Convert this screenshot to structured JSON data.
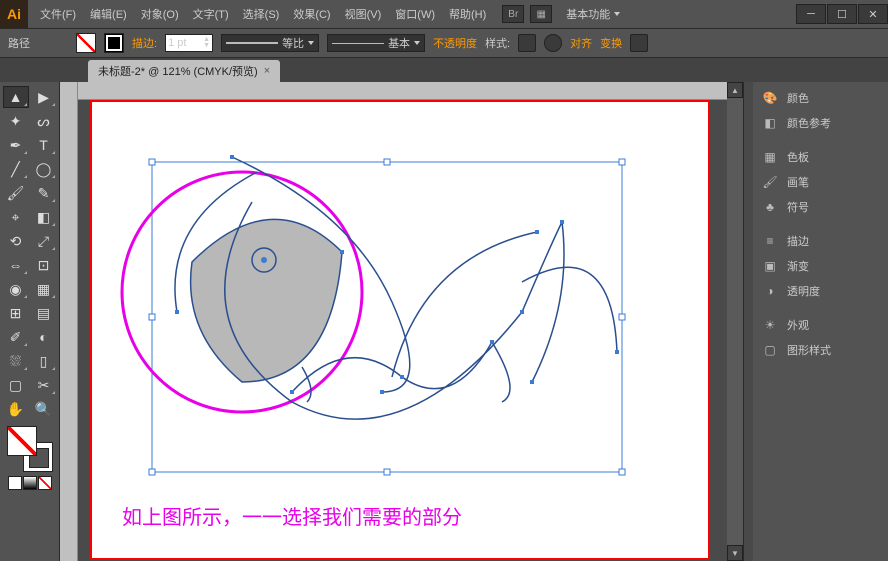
{
  "menus": [
    "文件(F)",
    "编辑(E)",
    "对象(O)",
    "文字(T)",
    "选择(S)",
    "效果(C)",
    "视图(V)",
    "窗口(W)",
    "帮助(H)"
  ],
  "workspace": "基本功能",
  "controlbar": {
    "path_label": "路径",
    "stroke_label": "描边:",
    "stroke_pt": "1 pt",
    "proportion": "等比",
    "style_basic": "基本",
    "opacity_label": "不透明度",
    "style_label": "样式:",
    "align_label": "对齐",
    "transform_label": "变换"
  },
  "tab": {
    "title": "未标题-2* @ 121% (CMYK/预览)",
    "close": "×"
  },
  "br_icon": "Br",
  "panels": {
    "g1": [
      {
        "icon": "palette",
        "label": "颜色"
      },
      {
        "icon": "guide",
        "label": "颜色参考"
      }
    ],
    "g2": [
      {
        "icon": "swatches",
        "label": "色板"
      },
      {
        "icon": "brushes",
        "label": "画笔"
      },
      {
        "icon": "symbols",
        "label": "符号"
      }
    ],
    "g3": [
      {
        "icon": "stroke",
        "label": "描边"
      },
      {
        "icon": "gradient",
        "label": "渐变"
      },
      {
        "icon": "transparency",
        "label": "透明度"
      }
    ],
    "g4": [
      {
        "icon": "appearance",
        "label": "外观"
      },
      {
        "icon": "graphic",
        "label": "图形样式"
      }
    ]
  },
  "caption": "如上图所示，一一选择我们需要的部分"
}
